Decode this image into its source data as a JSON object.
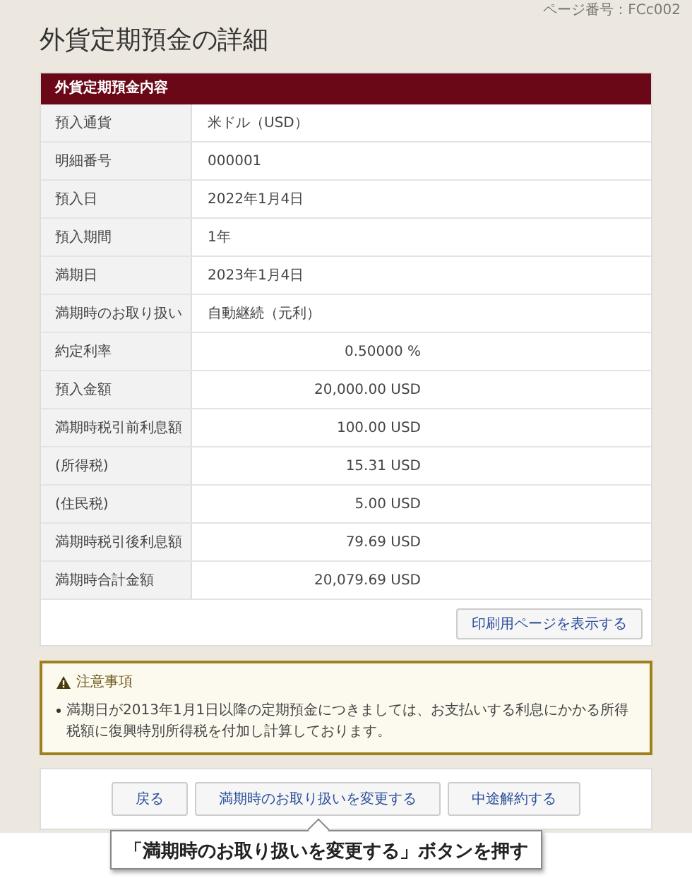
{
  "page_id": "ページ番号：FCc002",
  "title": "外貨定期預金の詳細",
  "section": {
    "heading": "外貨定期預金内容",
    "rows": [
      {
        "label": "預入通貨",
        "value": "米ドル（USD）",
        "kind": "text"
      },
      {
        "label": "明細番号",
        "value": "000001",
        "kind": "text"
      },
      {
        "label": "預入日",
        "value": "2022年1月4日",
        "kind": "text"
      },
      {
        "label": "預入期間",
        "value": "1年",
        "kind": "text"
      },
      {
        "label": "満期日",
        "value": "2023年1月4日",
        "kind": "text"
      },
      {
        "label": "満期時のお取り扱い",
        "value": "自動継続（元利）",
        "kind": "text"
      },
      {
        "label": "約定利率",
        "value": "0.50000 %",
        "kind": "amount"
      },
      {
        "label": "預入金額",
        "value": "20,000.00 USD",
        "kind": "amount"
      },
      {
        "label": "満期時税引前利息額",
        "value": "100.00 USD",
        "kind": "amount"
      },
      {
        "label": "(所得税)",
        "value": "15.31 USD",
        "kind": "amount"
      },
      {
        "label": "(住民税)",
        "value": "5.00 USD",
        "kind": "amount"
      },
      {
        "label": "満期時税引後利息額",
        "value": "79.69 USD",
        "kind": "amount"
      },
      {
        "label": "満期時合計金額",
        "value": "20,079.69 USD",
        "kind": "amount"
      }
    ],
    "print_button": "印刷用ページを表示する"
  },
  "notice": {
    "heading": "注意事項",
    "items": [
      "満期日が2013年1月1日以降の定期預金につきましては、お支払いする利息にかかる所得税額に復興特別所得税を付加し計算しております。"
    ]
  },
  "buttons": [
    "戻る",
    "満期時のお取り扱いを変更する",
    "中途解約する"
  ],
  "callout": {
    "text": "「満期時のお取り扱いを変更する」ボタンを押す"
  }
}
